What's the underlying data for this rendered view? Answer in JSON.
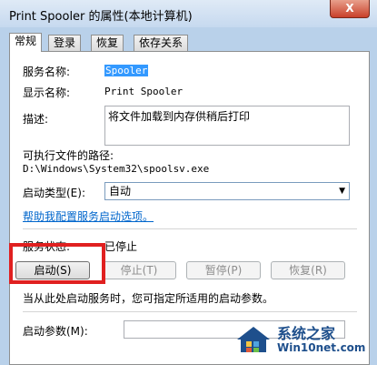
{
  "window": {
    "title": "Print Spooler 的属性(本地计算机)",
    "close_label": "X"
  },
  "tabs": [
    {
      "label": "常规",
      "active": true
    },
    {
      "label": "登录",
      "active": false
    },
    {
      "label": "恢复",
      "active": false
    },
    {
      "label": "依存关系",
      "active": false
    }
  ],
  "general": {
    "service_name_label": "服务名称:",
    "service_name_value": "Spooler",
    "display_name_label": "显示名称:",
    "display_name_value": "Print Spooler",
    "description_label": "描述:",
    "description_value": "将文件加载到内存供稍后打印",
    "exe_path_label": "可执行文件的路径:",
    "exe_path_value": "D:\\Windows\\System32\\spoolsv.exe",
    "startup_type_label": "启动类型(E):",
    "startup_type_value": "自动",
    "help_link": "帮助我配置服务启动选项。",
    "service_status_label": "服务状态:",
    "service_status_value": "已停止",
    "start_button": "启动(S)",
    "stop_button": "停止(T)",
    "pause_button": "暂停(P)",
    "resume_button": "恢复(R)",
    "start_params_hint": "当从此处启动服务时，您可指定所适用的启动参数。",
    "start_params_label": "启动参数(M):",
    "start_params_value": ""
  },
  "watermark": {
    "brand": "系统之家",
    "site": "Win10net.com"
  },
  "colors": {
    "highlight": "#e02020",
    "link": "#0066cc",
    "selection": "#3399ff"
  }
}
